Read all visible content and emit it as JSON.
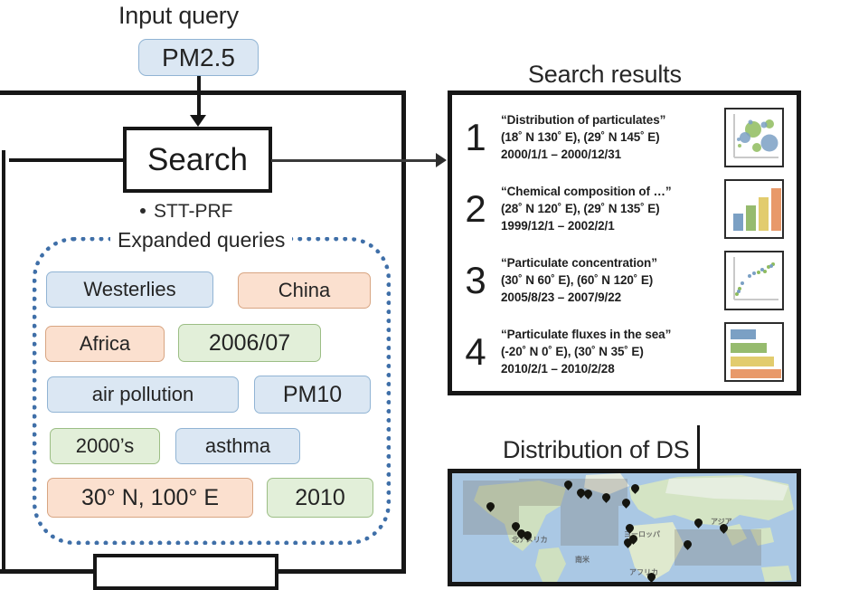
{
  "headings": {
    "input_query": "Input query",
    "search_results": "Search results",
    "distribution": "Distribution of DS"
  },
  "input": {
    "query_chip": "PM2.5"
  },
  "search": {
    "box_label": "Search",
    "method_bullet": "STT-PRF",
    "expanded_label": "Expanded queries"
  },
  "expanded_queries": [
    {
      "label": "Westerlies",
      "color": "blue"
    },
    {
      "label": "China",
      "color": "peach"
    },
    {
      "label": "Africa",
      "color": "peach"
    },
    {
      "label": "2006/07",
      "color": "green"
    },
    {
      "label": "air pollution",
      "color": "blue"
    },
    {
      "label": "PM10",
      "color": "blue"
    },
    {
      "label": "2000’s",
      "color": "green"
    },
    {
      "label": "asthma",
      "color": "blue"
    },
    {
      "label": "30° N, 100° E",
      "color": "peach"
    },
    {
      "label": "2010",
      "color": "green"
    }
  ],
  "results": [
    {
      "rank": "1",
      "title": "“Distribution of  particulates”",
      "coords": "(18˚ N 130˚ E), (29˚ N 145˚ E)",
      "period": "2000/1/1 – 2000/12/31",
      "thumb": "bubble-chart-icon"
    },
    {
      "rank": "2",
      "title": "“Chemical composition of …”",
      "coords": "(28˚ N 120˚ E), (29˚ N 135˚ E)",
      "period": "1999/12/1 – 2002/2/1",
      "thumb": "bar-chart-icon"
    },
    {
      "rank": "3",
      "title": "“Particulate concentration”",
      "coords": "(30˚ N 60˚ E), (60˚ N 120˚ E)",
      "period": "2005/8/23 – 2007/9/22",
      "thumb": "scatter-chart-icon"
    },
    {
      "rank": "4",
      "title": "“Particulate  fluxes in the sea”",
      "coords": "(-20˚ N 0˚ E), (30˚ N 35˚ E)",
      "period": "2010/2/1 – 2010/2/28",
      "thumb": "hbar-chart-icon"
    }
  ],
  "map": {
    "region_labels": [
      "北アメリカ",
      "ヨーロッパ",
      "アジア",
      "アフリカ",
      "南米"
    ]
  },
  "colors": {
    "chip_blue_fill": "#dbe7f3",
    "chip_blue_border": "#91b4d4",
    "chip_peach_fill": "#fbe0cf",
    "chip_peach_border": "#d8a582",
    "chip_green_fill": "#e2efd9",
    "chip_green_border": "#9cbe85",
    "oval_dots": "#3f6fa8",
    "frame": "#161616",
    "series_blue": "#7ba0c4",
    "series_green": "#96bb6e",
    "series_yellow": "#e2cc6e",
    "series_orange": "#e8996a"
  }
}
